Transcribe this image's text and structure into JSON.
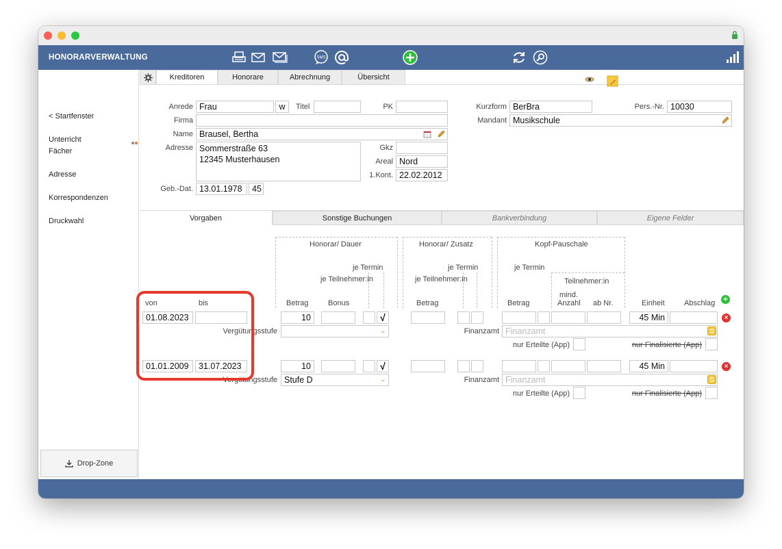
{
  "header": {
    "app_title": "HONORARVERWALTUNG",
    "icons": [
      "printer-icon",
      "mail-icon",
      "mail-stack-icon",
      "sms-icon",
      "at-icon",
      "add-icon",
      "refresh-icon",
      "search-icon",
      "signal-icon"
    ],
    "sms_label": "SMS"
  },
  "sidebar": {
    "items": [
      {
        "label": "< Startfenster"
      },
      {
        "label": "Unterricht"
      },
      {
        "label": "Fächer"
      },
      {
        "label": "Adresse"
      },
      {
        "label": "Korrespondenzen"
      },
      {
        "label": "Druckwahl"
      }
    ],
    "dropzone": "Drop-Zone"
  },
  "tabs": [
    "Kreditoren",
    "Honorare",
    "Abrechnung",
    "Übersicht"
  ],
  "person": {
    "anrede_label": "Anrede",
    "anrede": "Frau",
    "gender": "w",
    "titel_label": "Titel",
    "titel": "",
    "pk_label": "PK",
    "pk": "",
    "firma_label": "Firma",
    "firma": "",
    "name_label": "Name",
    "name": "Brausel, Bertha",
    "adresse_label": "Adresse",
    "adresse_line1": "Sommerstraße 63",
    "adresse_line2": "12345 Musterhausen",
    "gkz_label": "Gkz",
    "gkz": "",
    "areal_label": "Areal",
    "areal": "Nord",
    "kont_label": "1.Kont.",
    "kont": "22.02.2012",
    "geb_label": "Geb.-Dat.",
    "geb": "13.01.1978",
    "age": "45",
    "kurzform_label": "Kurzform",
    "kurzform": "BerBra",
    "persnr_label": "Pers.-Nr.",
    "persnr": "10030",
    "mandant_label": "Mandant",
    "mandant": "Musikschule"
  },
  "subtabs": [
    "Vorgaben",
    "Sonstige Buchungen",
    "Bankverbindung",
    "Eigene Felder"
  ],
  "grid": {
    "group_dauer": "Honorar/ Dauer",
    "group_zusatz": "Honorar/ Zusatz",
    "group_kopf": "Kopf-Pauschale",
    "je_termin": "je Termin",
    "je_teilnehmer": "je Teilnehmer:in",
    "teilnehmer": "Teilnehmer:in",
    "col_von": "von",
    "col_bis": "bis",
    "col_betrag": "Betrag",
    "col_bonus": "Bonus",
    "col_mind": "mind.",
    "col_anzahl": "Anzahl",
    "col_abnr": "ab Nr.",
    "col_einheit": "Einheit",
    "col_abschlag": "Abschlag",
    "verguetung_label": "Vergütungsstufe",
    "finanzamt_label": "Finanzamt",
    "finanzamt_placeholder": "Finanzamt",
    "nur_erteilte": "nur Erteilte (App)",
    "nur_finalisierte": "nur Finalisierte (App)",
    "rows": [
      {
        "von": "01.08.2023",
        "bis": "",
        "betrag": "10",
        "check": "√",
        "einheit": "45 Min",
        "stufe": ""
      },
      {
        "von": "01.01.2009",
        "bis": "31.07.2023",
        "betrag": "10",
        "check": "√",
        "einheit": "45 Min",
        "stufe": "Stufe D"
      }
    ]
  },
  "colors": {
    "header": "#4a6a9c",
    "highlight": "#e53a2b",
    "add": "#2ebd3c",
    "delete": "#e03030"
  }
}
